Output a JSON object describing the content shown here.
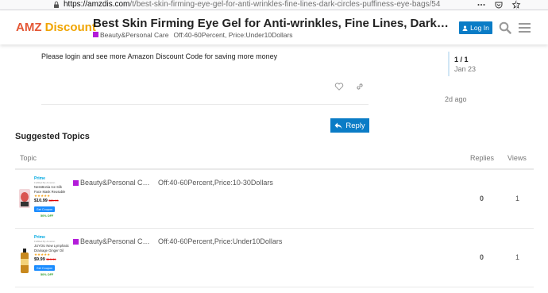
{
  "browser": {
    "url_host": "https://amzdis.com",
    "url_path": "/t/best-skin-firming-eye-gel-for-anti-wrinkles-fine-lines-dark-circles-puffiness-eye-bags/54"
  },
  "header": {
    "logo_part1": "AMZ",
    "logo_part2": "Discount",
    "title": "Best Skin Firming Eye Gel for Anti-wrinkles, Fine Lines, Dark Circles, Puffiness, Eye Bags",
    "category": "Beauty&Personal Care",
    "tags": "Off:40-60Percent, Price:Under10Dollars",
    "login_label": "Log In"
  },
  "post": {
    "text": "Please login and see more Amazon Discount Code for saving more money"
  },
  "timeline": {
    "position": "1 / 1",
    "date": "Jan 23",
    "ago": "2d ago"
  },
  "reply_label": "Reply",
  "suggested": {
    "title": "Suggested Topics",
    "col_topic": "Topic",
    "col_replies": "Replies",
    "col_views": "Views",
    "rows": [
      {
        "prime": "Prime",
        "fulfilled": "Fulfilled By Amazon",
        "product": "NessBonia Ice Silk Face Mask Reusable 3D",
        "stars": "★★★★★",
        "price": "$10.99",
        "old_price": "$21.99",
        "coupon": "Get Coupon",
        "off": "50% OFF",
        "category": "Beauty&Personal C…",
        "tags": "Off:40-60Percent,Price:10-30Dollars",
        "replies": "0",
        "views": "1"
      },
      {
        "prime": "Prime",
        "fulfilled": "Fulfilled By Amazon",
        "product": "JUYOU New Lymphatic Drainage Ginger Oil",
        "stars": "★★★★★",
        "price": "$9.99",
        "old_price": "$19.99",
        "coupon": "Get Coupon",
        "off": "50% OFF",
        "category": "Beauty&Personal C…",
        "tags": "Off:40-60Percent,Price:Under10Dollars",
        "replies": "0",
        "views": "1"
      }
    ]
  },
  "colors": {
    "accent": "#0a7cc6",
    "category": "#b31cd9",
    "logo_amz": "#e45735",
    "logo_discount": "#f0a400"
  }
}
